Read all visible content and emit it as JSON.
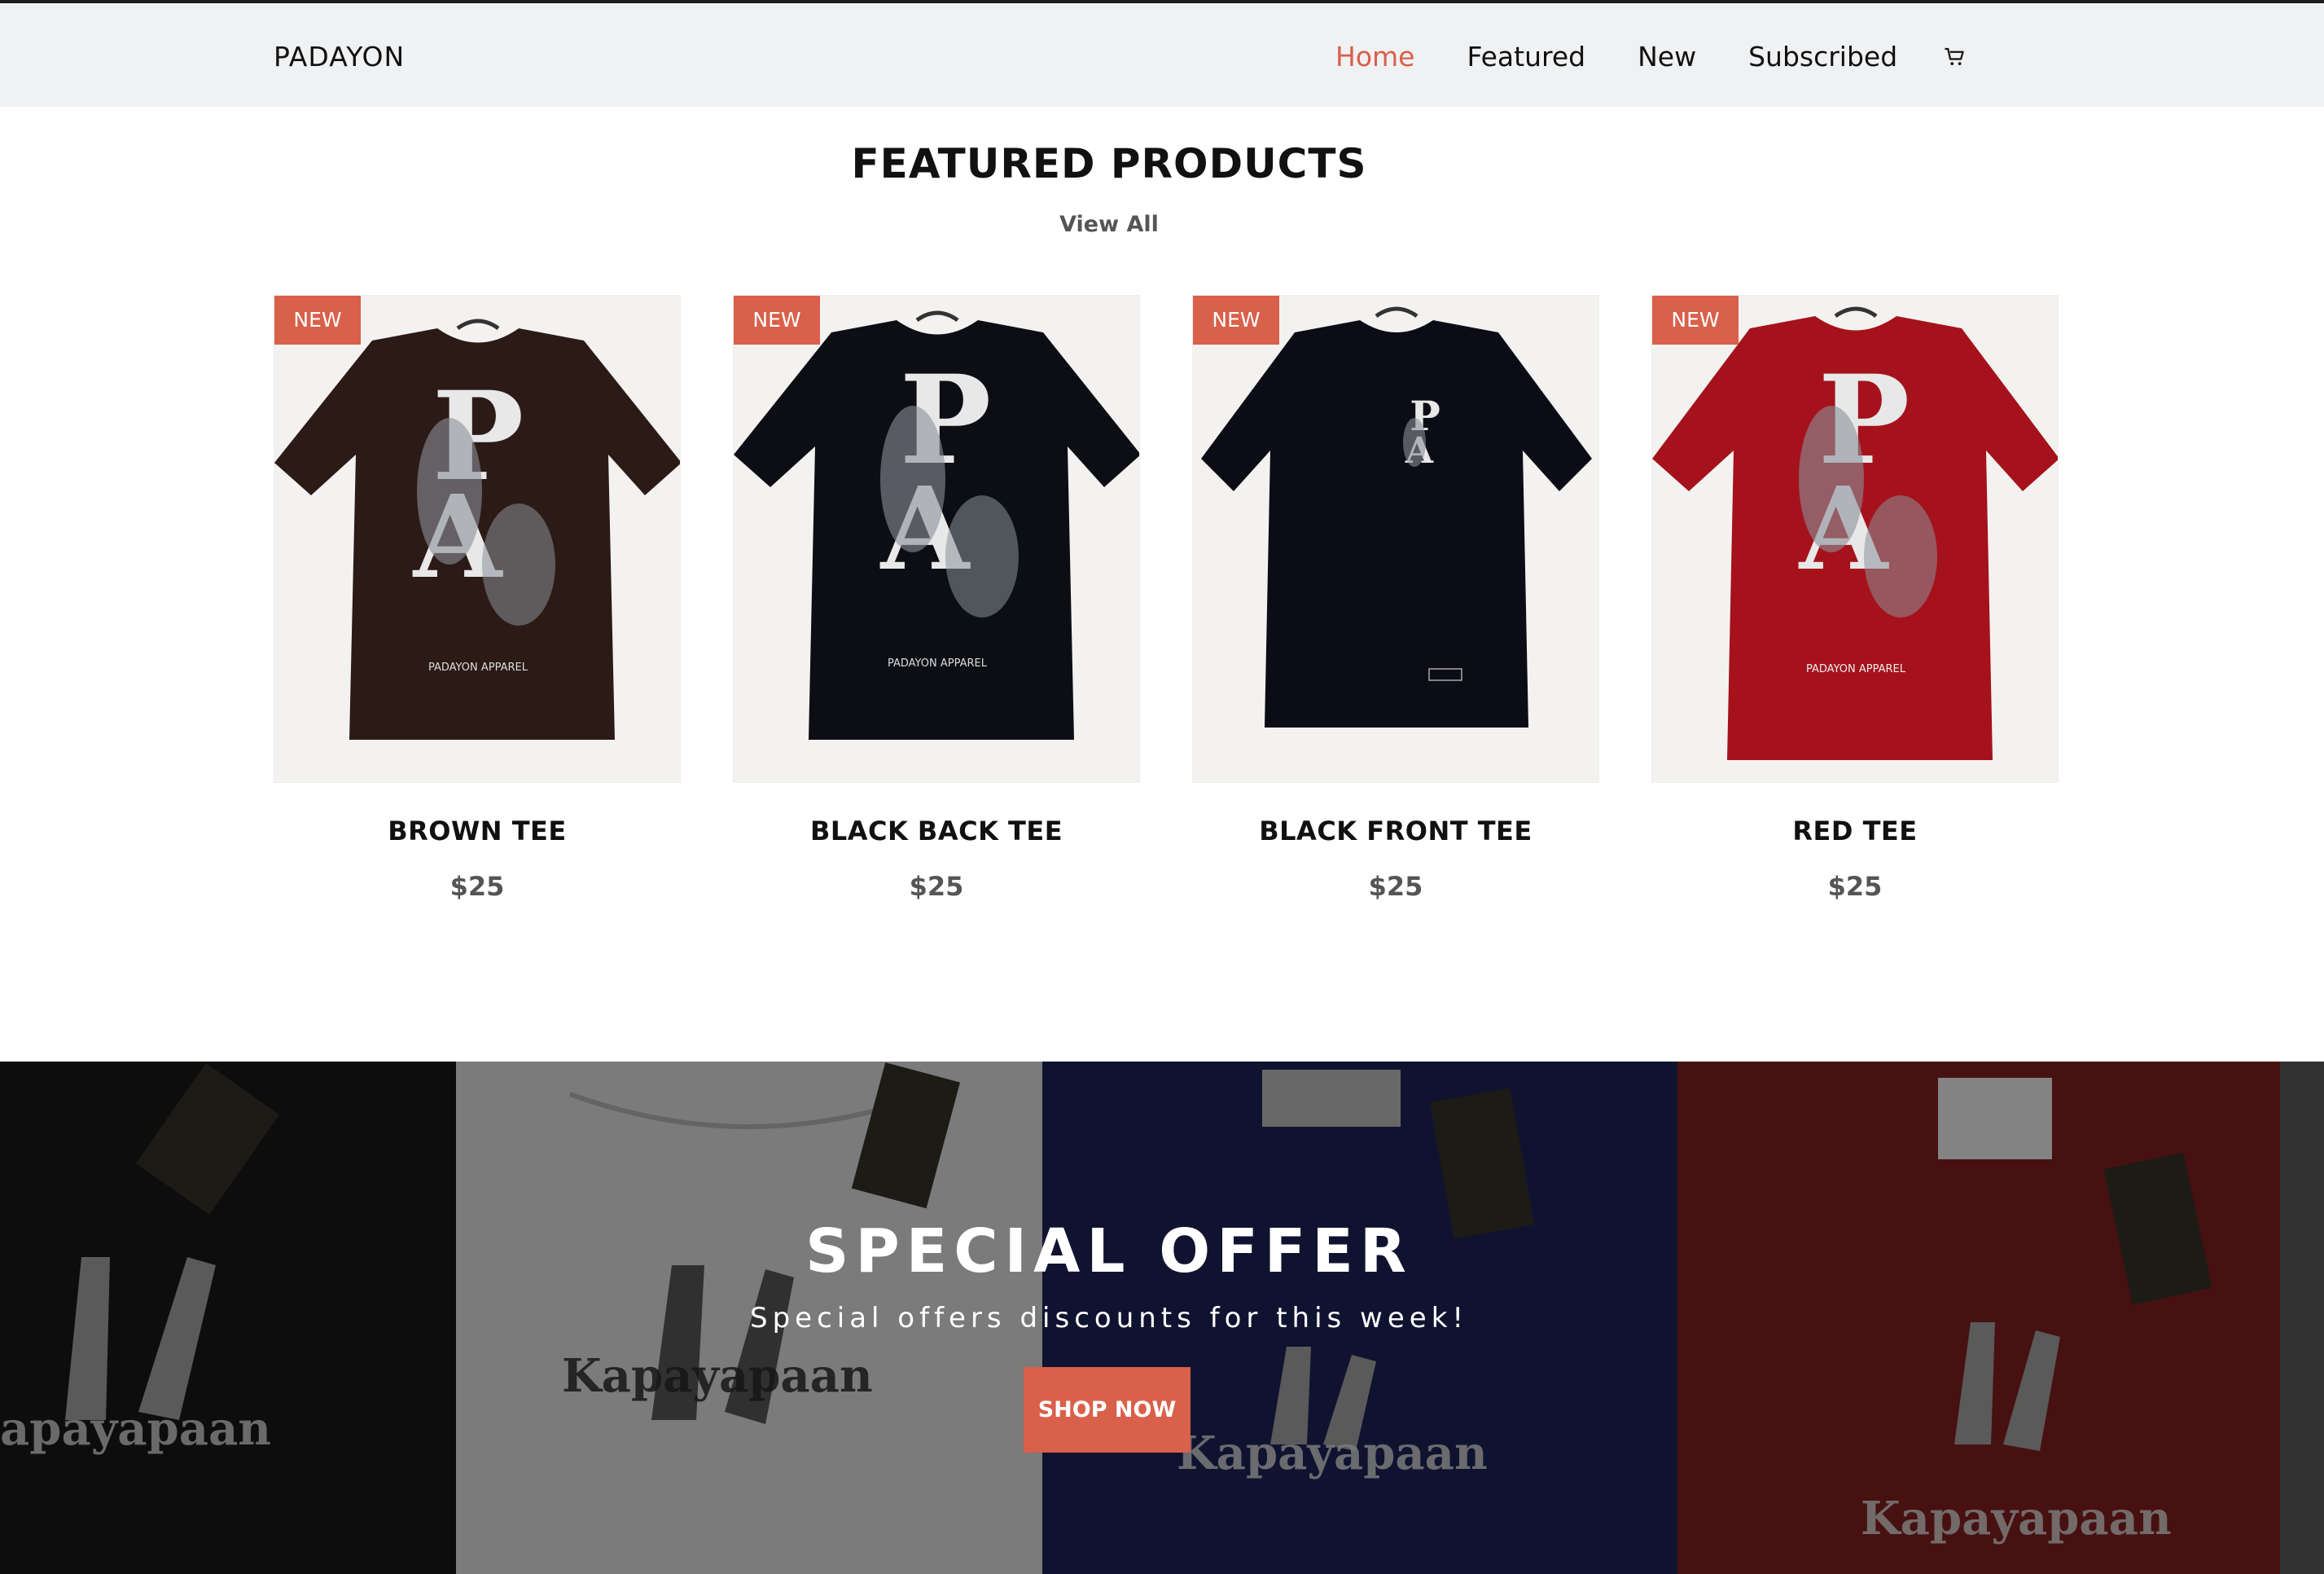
{
  "brand": "PADAYON",
  "nav": {
    "items": [
      "Home",
      "Featured",
      "New",
      "Subscribed"
    ],
    "active": "Home",
    "cart_icon": "cart-icon"
  },
  "featured": {
    "title": "FEATURED PRODUCTS",
    "view_all": "View All",
    "products": [
      {
        "badge": "NEW",
        "name": "BROWN TEE",
        "price": "$25",
        "shirt_color": "#2b1a16",
        "print": "back"
      },
      {
        "badge": "NEW",
        "name": "BLACK BACK TEE",
        "price": "$25",
        "shirt_color": "#0d0e14",
        "print": "back"
      },
      {
        "badge": "NEW",
        "name": "BLACK FRONT TEE",
        "price": "$25",
        "shirt_color": "#0b0c16",
        "print": "front"
      },
      {
        "badge": "NEW",
        "name": "RED TEE",
        "price": "$25",
        "shirt_color": "#a5121c",
        "print": "back"
      }
    ]
  },
  "offer": {
    "title": "SPECIAL OFFER",
    "subtitle": "Special offers discounts for this week!",
    "button": "SHOP NOW"
  },
  "colors": {
    "accent": "#d9604a",
    "navbar_bg": "#f0f1f3"
  }
}
